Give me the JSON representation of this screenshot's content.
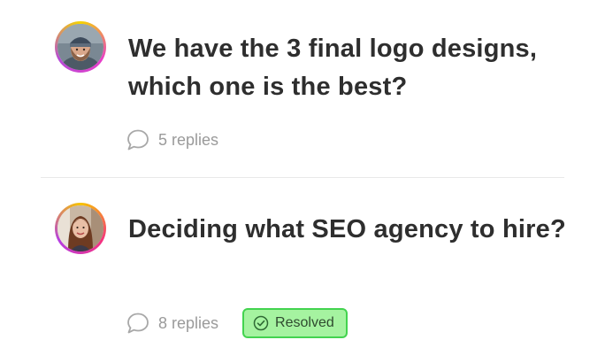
{
  "threads": [
    {
      "title": "We have the 3 final logo designs, which one is the best?",
      "replies": "5 replies",
      "avatar": "avatar-man-beanie",
      "reply_icon": "comment-bubble-icon"
    },
    {
      "title": "Deciding what SEO agency to hire?",
      "replies": "8 replies",
      "avatar": "avatar-woman-long-hair",
      "reply_icon": "comment-bubble-icon",
      "status": "Resolved",
      "status_icon": "check-circle-icon"
    }
  ],
  "colors": {
    "title": "#2e2e2e",
    "muted": "#9a9a9a",
    "divider": "#e8e8e8",
    "badge_bg": "#a5f3a0",
    "badge_border": "#43d34f",
    "badge_text": "#2f4a2f"
  }
}
